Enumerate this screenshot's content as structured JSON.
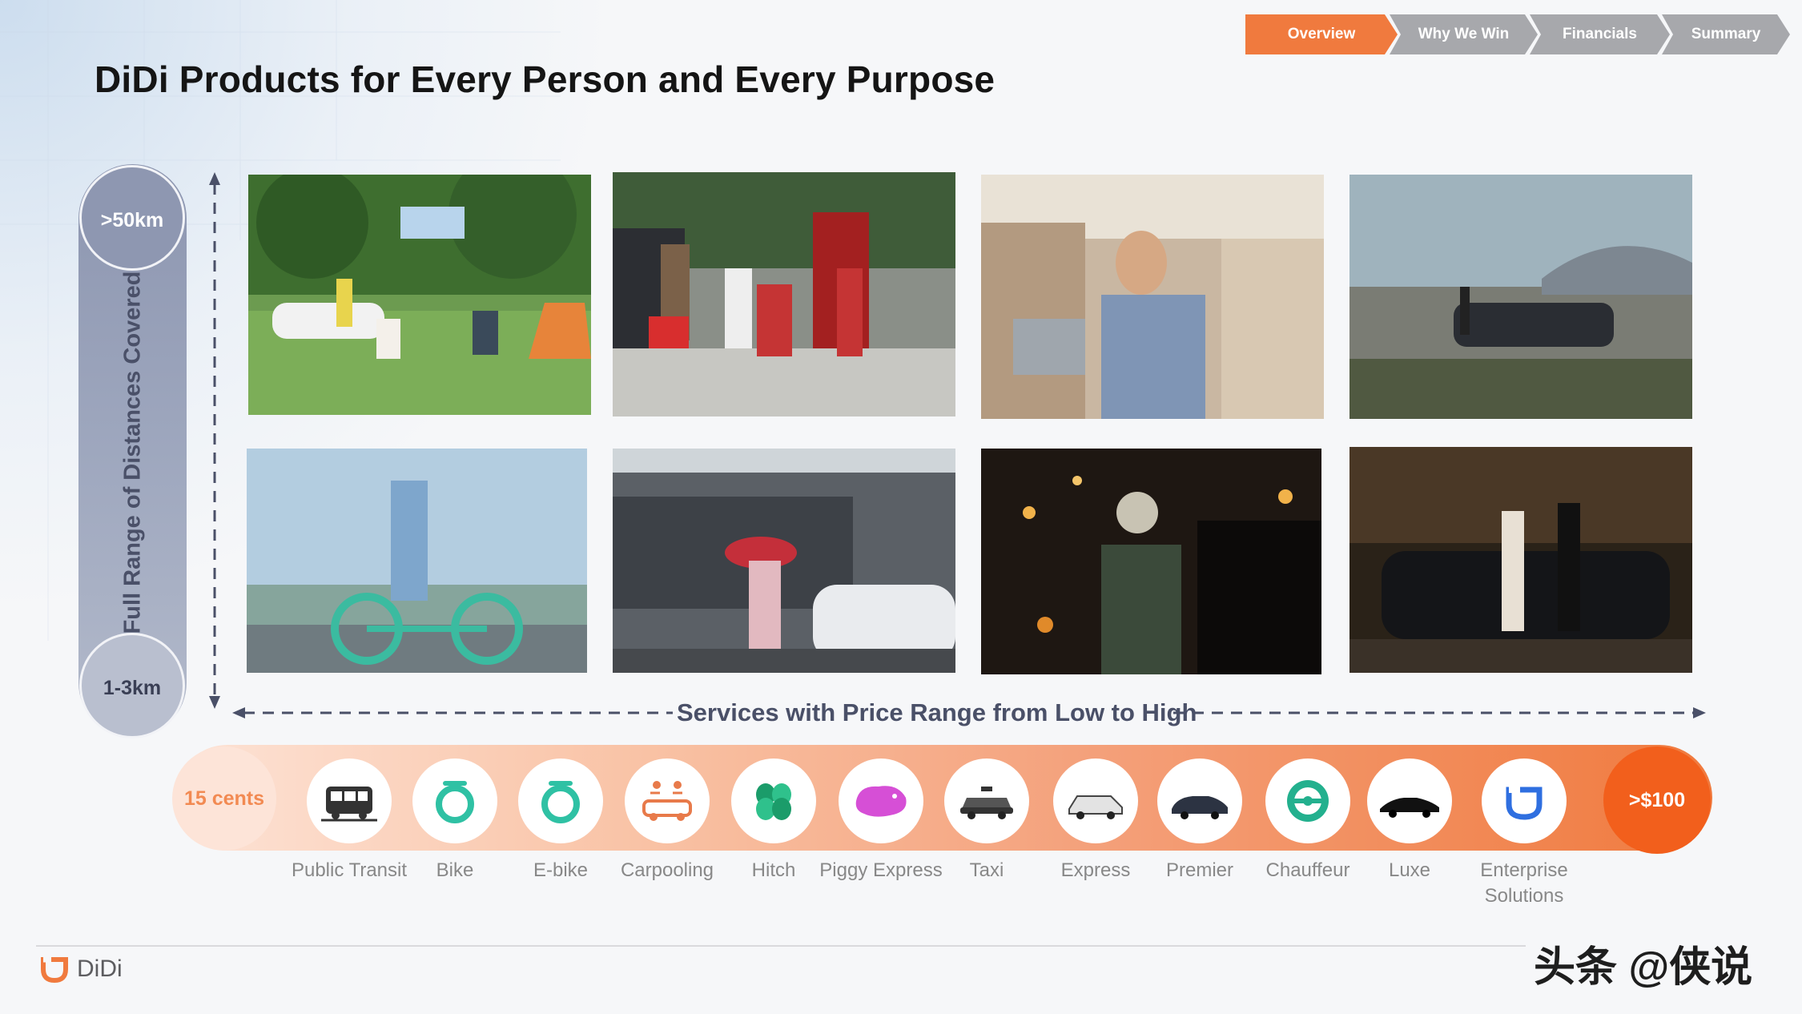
{
  "nav": {
    "tabs": [
      {
        "label": "Overview",
        "active": true
      },
      {
        "label": "Why We Win",
        "active": false
      },
      {
        "label": "Financials",
        "active": false
      },
      {
        "label": "Summary",
        "active": false
      }
    ]
  },
  "title": "DiDi Products for Every Person and Every Purpose",
  "distance": {
    "top_label": ">50km",
    "bottom_label": "1-3km",
    "axis_label": "Full Range of Distances Covered"
  },
  "photos": [
    {
      "name": "photo-picnic"
    },
    {
      "name": "photo-family-new-year"
    },
    {
      "name": "photo-business-rider"
    },
    {
      "name": "photo-airport-sedan"
    },
    {
      "name": "photo-bike-rider"
    },
    {
      "name": "photo-couple-umbrella"
    },
    {
      "name": "photo-chauffeur-night"
    },
    {
      "name": "photo-luxe-arrival"
    }
  ],
  "price": {
    "caption": "Services with Price Range from Low to High",
    "low_label": "15 cents",
    "high_label": ">$100"
  },
  "services": [
    {
      "label": "Public Transit",
      "icon": "bus-icon"
    },
    {
      "label": "Bike",
      "icon": "bike-icon"
    },
    {
      "label": "E-bike",
      "icon": "ebike-icon"
    },
    {
      "label": "Carpooling",
      "icon": "carpool-icon"
    },
    {
      "label": "Hitch",
      "icon": "hitch-icon"
    },
    {
      "label": "Piggy Express",
      "icon": "piggy-icon"
    },
    {
      "label": "Taxi",
      "icon": "taxi-icon"
    },
    {
      "label": "Express",
      "icon": "express-car-icon"
    },
    {
      "label": "Premier",
      "icon": "premier-car-icon"
    },
    {
      "label": "Chauffeur",
      "icon": "steering-wheel-icon"
    },
    {
      "label": "Luxe",
      "icon": "luxe-car-icon"
    },
    {
      "label": "Enterprise Solutions",
      "icon": "didi-enterprise-icon"
    }
  ],
  "footer": {
    "logo_text": "DiDi",
    "watermark": "头条 @侠说"
  },
  "colors": {
    "accent": "#f07a3e",
    "accent_dark": "#f25f1c",
    "nav_inactive": "#a7a8ac",
    "distance_bar": "#8e97b1"
  }
}
